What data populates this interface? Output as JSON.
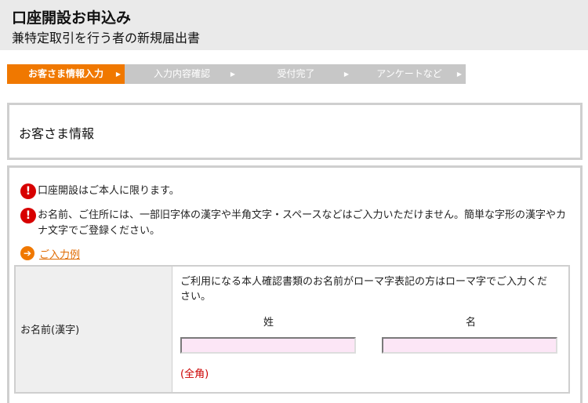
{
  "header": {
    "title": "口座開設お申込み",
    "subtitle": "兼特定取引を行う者の新規届出書"
  },
  "steps": [
    {
      "label": "お客さま情報入力",
      "active": true
    },
    {
      "label": "入力内容確認",
      "active": false
    },
    {
      "label": "受付完了",
      "active": false
    },
    {
      "label": "アンケートなど",
      "active": false
    }
  ],
  "section": {
    "title": "お客さま情報"
  },
  "notices": [
    "口座開設はご本人に限ります。",
    "お名前、ご住所には、一部旧字体の漢字や半角文字・スペースなどはご入力いただけません。簡単な字形の漢字やカナ文字でご登録ください。"
  ],
  "example_link": "ご入力例",
  "form": {
    "name_label": "お名前(漢字)",
    "note": "ご利用になる本人確認書類のお名前がローマ字表記の方はローマ字でご入力ください。",
    "surname_label": "姓",
    "given_label": "名",
    "surname_value": "",
    "given_value": "",
    "width_hint": "(全角)"
  },
  "colors": {
    "accent": "#f07800",
    "warning": "#d70000",
    "input_bg": "#fce6f6"
  }
}
